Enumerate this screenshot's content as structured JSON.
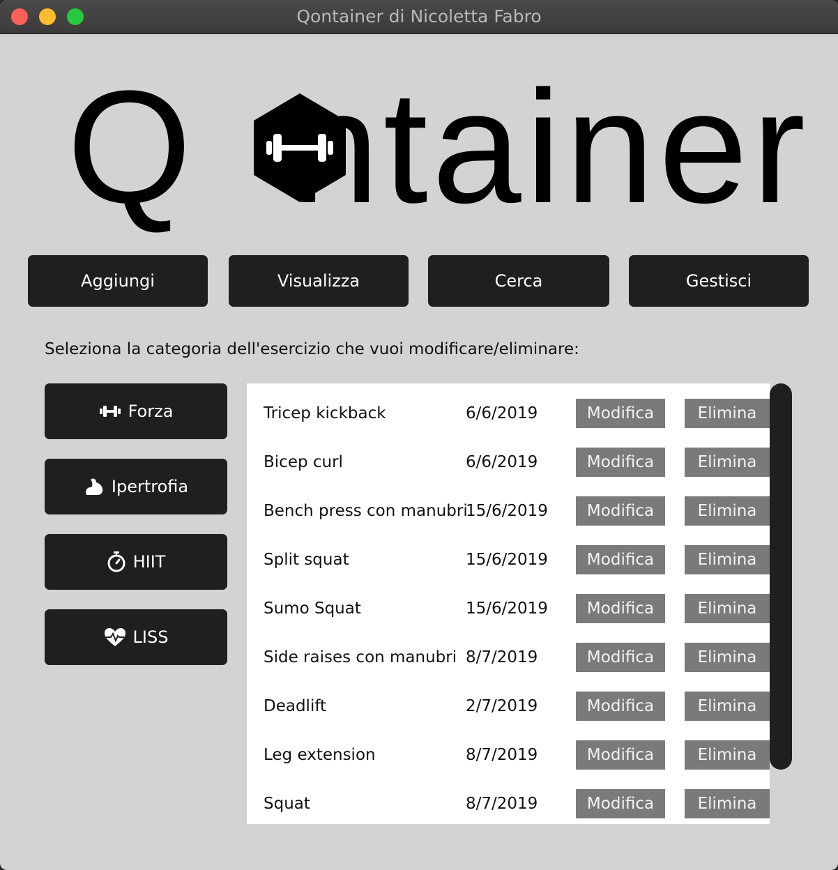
{
  "window": {
    "title": "Qontainer di Nicoletta Fabro"
  },
  "logo": {
    "text_prefix": "Q",
    "text_suffix": "ntainer"
  },
  "nav": {
    "add": "Aggiungi",
    "view": "Visualizza",
    "search": "Cerca",
    "manage": "Gestisci"
  },
  "instruction": "Seleziona la categoria dell'esercizio che vuoi modificare/eliminare:",
  "categories": [
    {
      "label": "Forza",
      "icon": "dumbbell-icon"
    },
    {
      "label": "Ipertrofia",
      "icon": "flexed-arm-icon"
    },
    {
      "label": "HIIT",
      "icon": "stopwatch-icon"
    },
    {
      "label": "LISS",
      "icon": "heart-pulse-icon"
    }
  ],
  "exercises": [
    {
      "name": "Tricep kickback",
      "date": "6/6/2019",
      "edit": "Modifica",
      "delete": "Elimina"
    },
    {
      "name": "Bicep curl",
      "date": "6/6/2019",
      "edit": "Modifica",
      "delete": "Elimina"
    },
    {
      "name": "Bench press con manubri",
      "date": "15/6/2019",
      "edit": "Modifica",
      "delete": "Elimina"
    },
    {
      "name": "Split squat",
      "date": "15/6/2019",
      "edit": "Modifica",
      "delete": "Elimina"
    },
    {
      "name": "Sumo Squat",
      "date": "15/6/2019",
      "edit": "Modifica",
      "delete": "Elimina"
    },
    {
      "name": "Side raises con manubri",
      "date": "8/7/2019",
      "edit": "Modifica",
      "delete": "Elimina"
    },
    {
      "name": "Deadlift",
      "date": "2/7/2019",
      "edit": "Modifica",
      "delete": "Elimina"
    },
    {
      "name": "Leg extension",
      "date": "8/7/2019",
      "edit": "Modifica",
      "delete": "Elimina"
    },
    {
      "name": "Squat",
      "date": "8/7/2019",
      "edit": "Modifica",
      "delete": "Elimina"
    }
  ],
  "colors": {
    "background": "#d4d3d4",
    "button_dark": "#1f1f1f",
    "button_grey": "#7a7a7a"
  }
}
